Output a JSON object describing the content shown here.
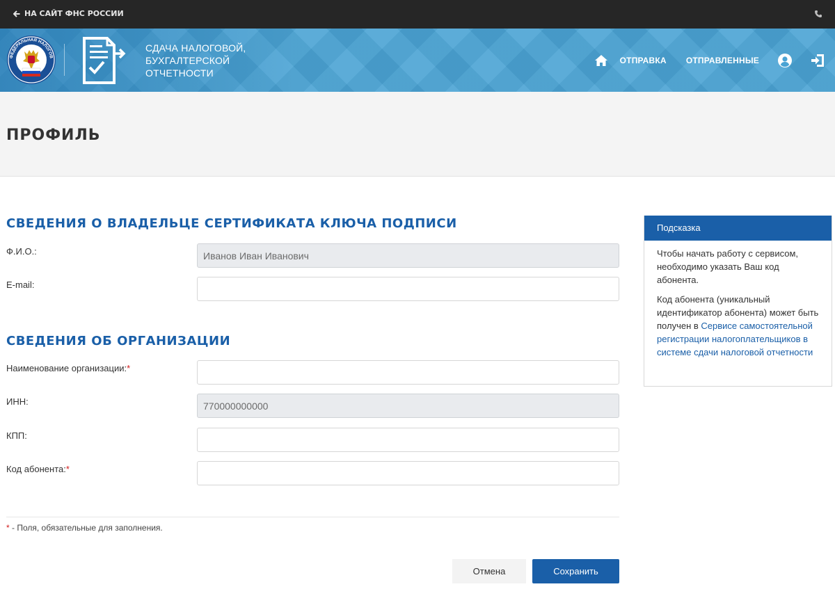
{
  "topbar": {
    "back_label": "НА САЙТ ФНС РОССИИ",
    "back_icon": "arrow-left-icon",
    "phone_icon": "phone-icon"
  },
  "header": {
    "title_lines": [
      "СДАЧА НАЛОГОВОЙ,",
      "БУХГАЛТЕРСКОЙ",
      "ОТЧЕТНОСТИ"
    ],
    "emblem_text": "ФЕДЕРАЛЬНАЯ НАЛОГОВАЯ СЛУЖБА",
    "nav": {
      "home_icon": "home-icon",
      "send_label": "ОТПРАВКА",
      "sent_label": "ОТПРАВЛЕННЫЕ",
      "user_icon": "user-icon",
      "logout_icon": "logout-icon"
    }
  },
  "page": {
    "title": "ПРОФИЛЬ"
  },
  "owner_section": {
    "title": "СВЕДЕНИЯ О ВЛАДЕЛЬЦЕ СЕРТИФИКАТА КЛЮЧА ПОДПИСИ",
    "fio_label": "Ф.И.О.:",
    "fio_value": "Иванов Иван Иванович",
    "email_label": "E-mail:",
    "email_value": ""
  },
  "org_section": {
    "title": "СВЕДЕНИЯ ОБ ОРГАНИЗАЦИИ",
    "name_label": "Наименование организации:",
    "name_value": "",
    "inn_label": "ИНН:",
    "inn_value": "770000000000",
    "kpp_label": "КПП:",
    "kpp_value": "",
    "subscriber_label": "Код абонента:",
    "subscriber_value": "",
    "required_mark": "*"
  },
  "footer": {
    "required_star": "*",
    "required_note": " - Поля, обязательные для заполнения.",
    "cancel_label": "Отмена",
    "save_label": "Сохранить"
  },
  "hint": {
    "title": "Подсказка",
    "paragraph1": "Чтобы начать работу с сервисом, необходимо указать Ваш код абонента.",
    "paragraph2_text": "Код абонента (уникальный идентификатор абонента) может быть получен в ",
    "paragraph2_link": "Сервисе самостоятельной регистрации налогоплательщиков в системе сдачи налоговой отчетности"
  },
  "colors": {
    "topbar": "#262626",
    "header_blue": "#4aa3d4",
    "accent_blue": "#1a5fa8",
    "required_red": "#d21b1b"
  }
}
